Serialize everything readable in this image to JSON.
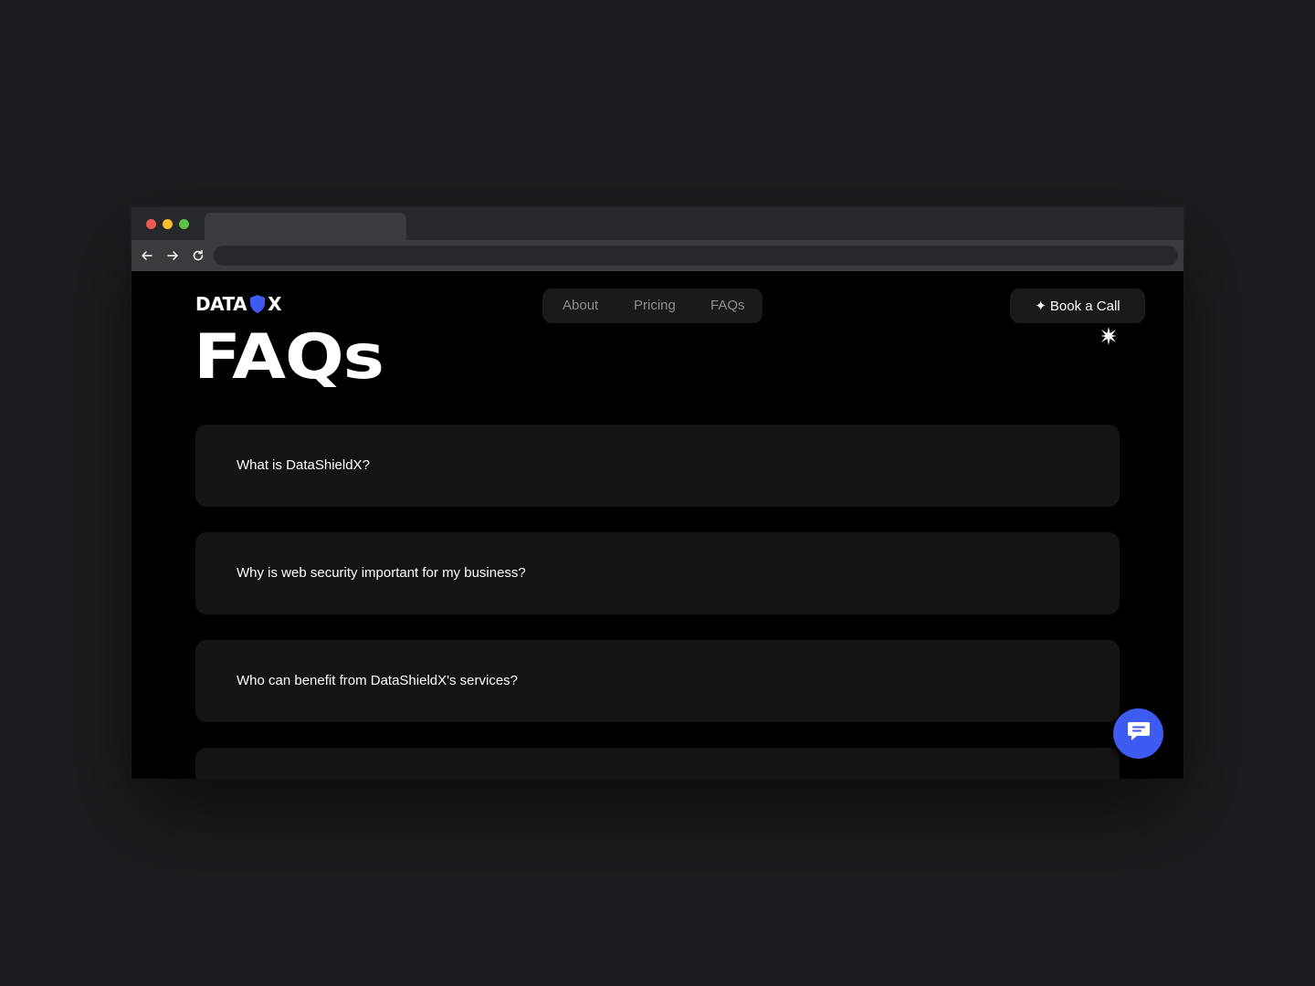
{
  "brand": {
    "part1": "DATA",
    "part2": "X",
    "accent": "#3d5af1"
  },
  "nav": {
    "items": [
      {
        "label": "About"
      },
      {
        "label": "Pricing"
      },
      {
        "label": "FAQs"
      }
    ]
  },
  "cta": {
    "star": "✦",
    "label": "Book a Call"
  },
  "page": {
    "title": "FAQs"
  },
  "faqs": [
    {
      "question": "What is DataShieldX?"
    },
    {
      "question": "Why is web security important for my business?"
    },
    {
      "question": "Who can benefit from DataShieldX's services?"
    },
    {
      "question": ""
    }
  ],
  "icons": {
    "logo_mark": "shield-icon",
    "chat": "chat-icon",
    "sparkle": "sparkle-icon",
    "back": "arrow-left-icon",
    "forward": "arrow-right-icon",
    "reload": "reload-icon"
  },
  "colors": {
    "chat_button": "#3d5af1",
    "page_bg": "#000000",
    "card_bg": "#141415"
  }
}
